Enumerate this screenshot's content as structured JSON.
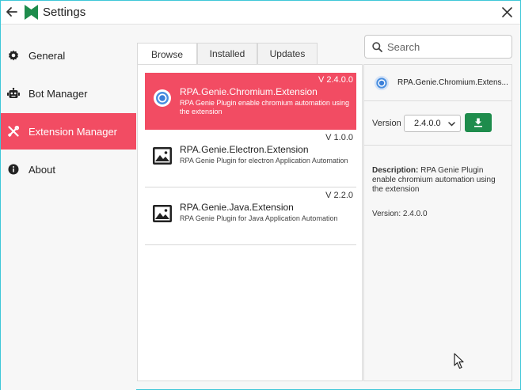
{
  "window": {
    "title": "Settings"
  },
  "sidebar": {
    "items": [
      {
        "label": "General",
        "icon": "gear-icon"
      },
      {
        "label": "Bot Manager",
        "icon": "robot-icon"
      },
      {
        "label": "Extension Manager",
        "icon": "tools-icon",
        "active": true
      },
      {
        "label": "About",
        "icon": "info-icon"
      }
    ]
  },
  "tabs": [
    {
      "label": "Browse",
      "active": true
    },
    {
      "label": "Installed"
    },
    {
      "label": "Updates"
    }
  ],
  "search": {
    "placeholder": "Search"
  },
  "extensions": [
    {
      "name": "RPA.Genie.Chromium.Extension",
      "version": "V 2.4.0.0",
      "description": "RPA Genie Plugin enable chromium automation using the extension",
      "icon": "chromium-icon",
      "selected": true
    },
    {
      "name": "RPA.Genie.Electron.Extension",
      "version": "V 1.0.0",
      "description": "RPA Genie Plugin for electron Application Automation",
      "icon": "image-icon"
    },
    {
      "name": "RPA.Genie.Java.Extension",
      "version": "V 2.2.0",
      "description": "RPA Genie Plugin for Java Application Automation",
      "icon": "image-icon"
    }
  ],
  "detail": {
    "name": "RPA.Genie.Chromium.Extens...",
    "version_label": "Version",
    "version_selected": "2.4.0.0",
    "description_label": "Description:",
    "description": "RPA Genie Plugin enable chromium automation using the extension",
    "version_info_label": "Version:",
    "version_info": "2.4.0.0"
  },
  "colors": {
    "accent": "#f24c63",
    "download_button": "#1e8c4c",
    "logo": "#1e8c4c",
    "window_border": "#3ec7d8"
  }
}
